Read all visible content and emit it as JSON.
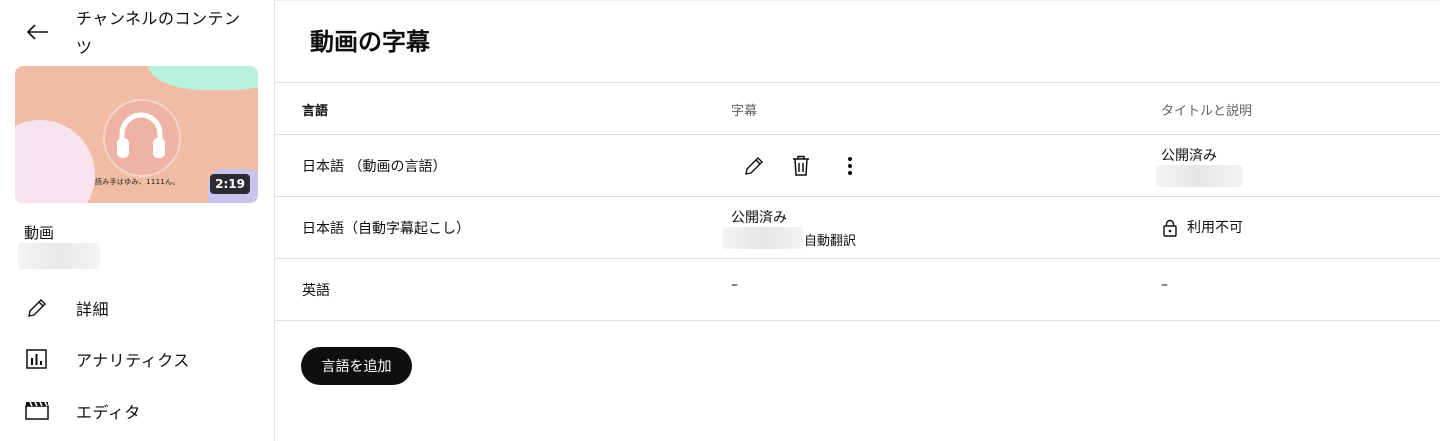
{
  "sidebar": {
    "channel_title": "チャンネルのコンテンツ",
    "thumbnail": {
      "duration": "2:19",
      "caption": "読み手はゆみ、1111ん。"
    },
    "video_label": "動画",
    "nav": [
      {
        "label": "詳細",
        "icon": "pencil-icon"
      },
      {
        "label": "アナリティクス",
        "icon": "analytics-icon"
      },
      {
        "label": "エディタ",
        "icon": "clapperboard-icon"
      }
    ]
  },
  "main": {
    "title": "動画の字幕",
    "columns": {
      "language": "言語",
      "subtitles": "字幕",
      "title_desc": "タイトルと説明"
    },
    "rows": [
      {
        "language": "日本語 （動画の言語）",
        "title_status": "公開済み"
      },
      {
        "language": "日本語（自動字幕起こし）",
        "subtitle_status": "公開済み",
        "subtitle_note": "自動翻訳",
        "title_status": "利用不可"
      },
      {
        "language": "英語",
        "subtitle_value": "–",
        "title_value": "–"
      }
    ],
    "add_language_button": "言語を追加"
  }
}
